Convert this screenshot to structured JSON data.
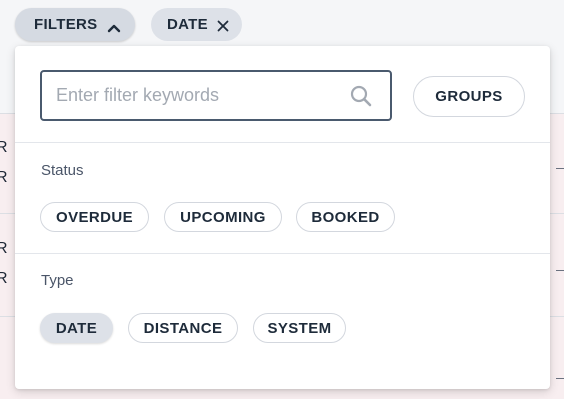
{
  "toolbar": {
    "filters_label": "FILTERS",
    "filters_icon": "chevron-up-icon",
    "active_filter_label": "DATE",
    "active_filter_icon": "close-icon"
  },
  "background": {
    "row_fragments": [
      "R",
      "R",
      "R",
      "R"
    ]
  },
  "panel": {
    "search": {
      "value": "",
      "placeholder": "Enter filter keywords",
      "icon": "search-icon"
    },
    "groups_label": "GROUPS",
    "status": {
      "label": "Status",
      "options": [
        "OVERDUE",
        "UPCOMING",
        "BOOKED"
      ]
    },
    "type": {
      "label": "Type",
      "options": [
        "DATE",
        "DISTANCE",
        "SYSTEM"
      ],
      "selected": "DATE"
    }
  },
  "colors": {
    "chip_bg": "#dde1e8",
    "text": "#1e2b3a",
    "input_border": "#4a5a6e",
    "placeholder": "#a3a9b2",
    "row_bg": "#f8eef0"
  }
}
